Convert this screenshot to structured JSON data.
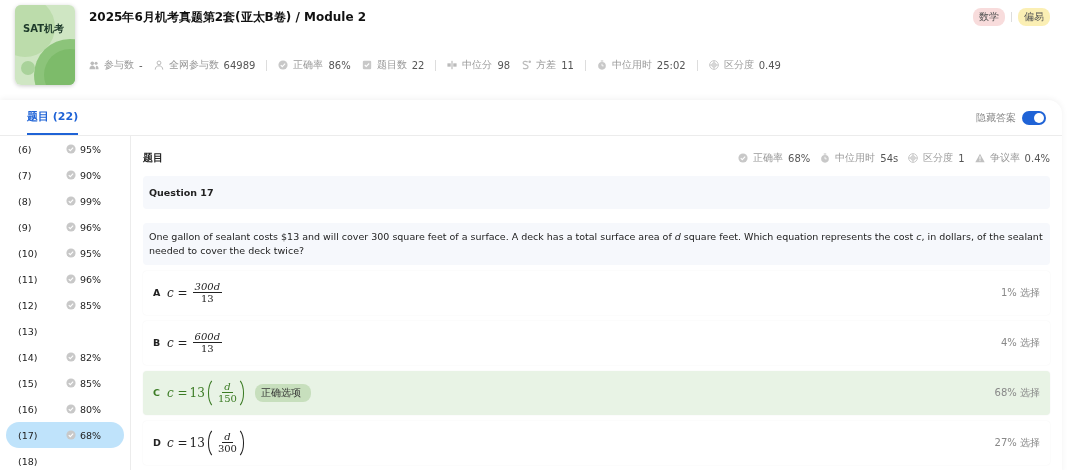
{
  "header": {
    "cover_label": "SAT机考",
    "title": "2025年6月机考真题第2套(亚太B卷) / Module 2",
    "tags": [
      {
        "label": "数学",
        "color": "#f8dcdc"
      },
      {
        "label": "偏易",
        "color": "#fbefb4"
      }
    ],
    "stats": [
      {
        "label": "参与数",
        "value": "-"
      },
      {
        "label": "全网参与数",
        "value": "64989"
      },
      {
        "label": "正确率",
        "value": "86%"
      },
      {
        "label": "题目数",
        "value": "22"
      },
      {
        "label": "中位分",
        "value": "98"
      },
      {
        "label": "方差",
        "value": "11"
      },
      {
        "label": "中位用时",
        "value": "25:02"
      },
      {
        "label": "区分度",
        "value": "0.49"
      }
    ]
  },
  "tabs": [
    {
      "label": "题目 (22)",
      "selected": true
    }
  ],
  "hide_answer": {
    "label": "隐藏答案",
    "on": true
  },
  "sidebar": {
    "items": [
      {
        "label": "(6)",
        "percent": "95%",
        "selected": false
      },
      {
        "label": "(7)",
        "percent": "90%",
        "selected": false
      },
      {
        "label": "(8)",
        "percent": "99%",
        "selected": false
      },
      {
        "label": "(9)",
        "percent": "96%",
        "selected": false
      },
      {
        "label": "(10)",
        "percent": "95%",
        "selected": false
      },
      {
        "label": "(11)",
        "percent": "96%",
        "selected": false
      },
      {
        "label": "(12)",
        "percent": "85%",
        "selected": false
      },
      {
        "label": "(13)",
        "selected": false
      },
      {
        "label": "(14)",
        "percent": "82%",
        "selected": false
      },
      {
        "label": "(15)",
        "percent": "85%",
        "selected": false
      },
      {
        "label": "(16)",
        "percent": "80%",
        "selected": false
      },
      {
        "label": "(17)",
        "percent": "68%",
        "selected": true
      },
      {
        "label": "(18)",
        "selected": false
      }
    ]
  },
  "question": {
    "section_label": "题目",
    "stats": [
      {
        "label": "正确率",
        "value": "68%"
      },
      {
        "label": "中位用时",
        "value": "54s"
      },
      {
        "label": "区分度",
        "value": "1"
      },
      {
        "label": "争议率",
        "value": "0.4%"
      }
    ],
    "heading": "Question 17",
    "text": "One gallon of sealant costs $13 and will cover 300 square feet of a surface. A deck has a total surface area of *d* square feet. Which equation represents the cost *c*, in dollars, of the sealant needed to cover the deck twice?",
    "options": [
      {
        "letter": "A",
        "lhs": "c =",
        "numerator": "300d",
        "denominator": "13",
        "parenthesized": false,
        "share": "1% 选择",
        "correct": false
      },
      {
        "letter": "B",
        "lhs": "c =",
        "numerator": "600d",
        "denominator": "13",
        "parenthesized": false,
        "share": "4% 选择",
        "correct": false
      },
      {
        "letter": "C",
        "lhs": "c =",
        "coefficient": "13",
        "numerator": "d",
        "denominator": "150",
        "parenthesized": true,
        "badge": "正确选项",
        "share": "68% 选择",
        "correct": true
      },
      {
        "letter": "D",
        "lhs": "c =",
        "coefficient": "13",
        "numerator": "d",
        "denominator": "300",
        "parenthesized": true,
        "share": "27% 选择",
        "correct": false
      }
    ]
  }
}
